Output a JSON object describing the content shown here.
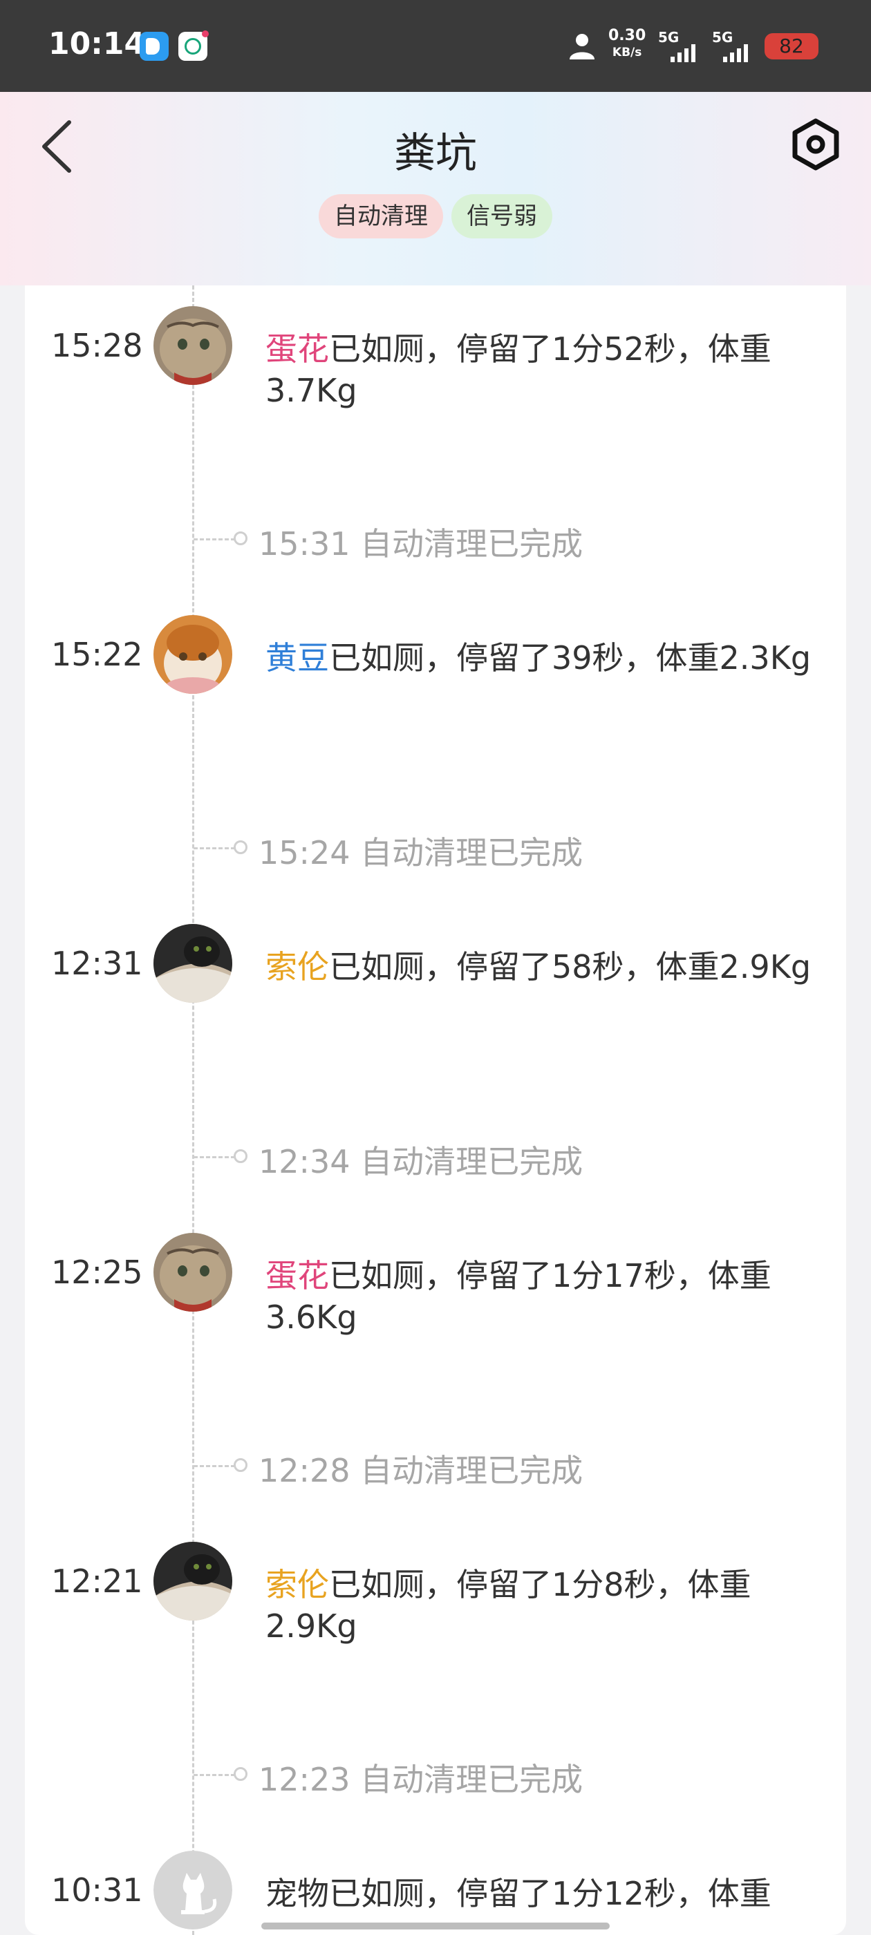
{
  "status_bar": {
    "time": "10:14",
    "net_speed": "0.30",
    "net_unit": "KB/s",
    "sig1": "5G",
    "sig2": "5G",
    "battery": "82"
  },
  "header": {
    "title": "粪坑",
    "badges": [
      "自动清理",
      "信号弱"
    ]
  },
  "events": [
    {
      "time": "15:28",
      "name": "蛋花",
      "name_color": "#e0457b",
      "text": "已如厕，停留了1分52秒，体重3.7Kg",
      "avatar": "cat-avatar-tabby",
      "clean": "15:31 自动清理已完成"
    },
    {
      "time": "15:22",
      "name": "黄豆",
      "name_color": "#2f7fd8",
      "text": "已如厕，停留了39秒，体重2.3Kg",
      "avatar": "cat-avatar-orange",
      "clean": "15:24 自动清理已完成"
    },
    {
      "time": "12:31",
      "name": "索伦",
      "name_color": "#e8a320",
      "text": "已如厕，停留了58秒，体重2.9Kg",
      "avatar": "cat-avatar-black",
      "clean": "12:34 自动清理已完成"
    },
    {
      "time": "12:25",
      "name": "蛋花",
      "name_color": "#e0457b",
      "text": "已如厕，停留了1分17秒，体重3.6Kg",
      "avatar": "cat-avatar-tabby",
      "clean": "12:28 自动清理已完成"
    },
    {
      "time": "12:21",
      "name": "索伦",
      "name_color": "#e8a320",
      "text": "已如厕，停留了1分8秒，体重2.9Kg",
      "avatar": "cat-avatar-black",
      "clean": "12:23 自动清理已完成"
    },
    {
      "time": "10:31",
      "name": "宠物",
      "name_color": "#333333",
      "text": "已如厕，停留了1分12秒，体重",
      "avatar": "cat-silhouette-icon",
      "clean": ""
    }
  ]
}
